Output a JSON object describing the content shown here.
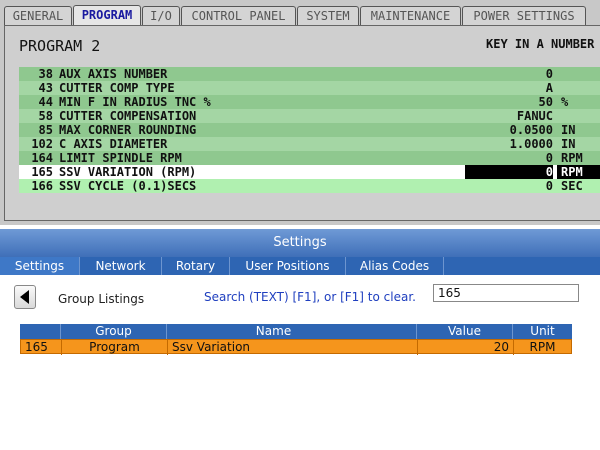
{
  "control": {
    "tabs": [
      {
        "label": "GENERAL",
        "active": false
      },
      {
        "label": "PROGRAM",
        "active": true
      },
      {
        "label": "I/O",
        "active": false
      },
      {
        "label": "CONTROL PANEL",
        "active": false
      },
      {
        "label": "SYSTEM",
        "active": false
      },
      {
        "label": "MAINTENANCE",
        "active": false
      },
      {
        "label": "POWER SETTINGS",
        "active": false
      }
    ],
    "title": "PROGRAM 2",
    "key_in": "KEY IN A NUMBER",
    "rows": [
      {
        "num": "38",
        "desc": "AUX AXIS NUMBER",
        "value": "0",
        "unit": ""
      },
      {
        "num": "43",
        "desc": "CUTTER COMP TYPE",
        "value": "A",
        "unit": ""
      },
      {
        "num": "44",
        "desc": "MIN F IN RADIUS TNC %",
        "value": "50",
        "unit": "%"
      },
      {
        "num": "58",
        "desc": "CUTTER COMPENSATION",
        "value": "FANUC",
        "unit": ""
      },
      {
        "num": "85",
        "desc": "MAX CORNER ROUNDING",
        "value": "0.0500",
        "unit": "IN"
      },
      {
        "num": "102",
        "desc": "C AXIS DIAMETER",
        "value": "1.0000",
        "unit": "IN"
      },
      {
        "num": "164",
        "desc": "LIMIT SPINDLE RPM",
        "value": "0",
        "unit": "RPM"
      },
      {
        "num": "165",
        "desc": "SSV VARIATION (RPM)",
        "value": "0",
        "unit": "RPM",
        "selected": true
      },
      {
        "num": "166",
        "desc": "SSV CYCLE (0.1)SECS",
        "value": "0",
        "unit": "SEC"
      }
    ]
  },
  "settings": {
    "title": "Settings",
    "tabs": [
      {
        "label": "Settings",
        "active": true
      },
      {
        "label": "Network",
        "active": false
      },
      {
        "label": "Rotary",
        "active": false
      },
      {
        "label": "User Positions",
        "active": false
      },
      {
        "label": "Alias Codes",
        "active": false
      }
    ],
    "group_label": "Group Listings",
    "search_hint": "Search (TEXT) [F1], or [F1] to clear.",
    "search_value": "165",
    "table": {
      "headers": [
        "",
        "Group",
        "Name",
        "",
        "Value",
        "Unit"
      ],
      "rows": [
        {
          "num": "165",
          "group": "Program",
          "name": "Ssv Variation",
          "value": "20",
          "unit": "RPM"
        }
      ]
    },
    "colors": {
      "accent": "#2e65b3",
      "highlight": "#f5951c"
    }
  }
}
